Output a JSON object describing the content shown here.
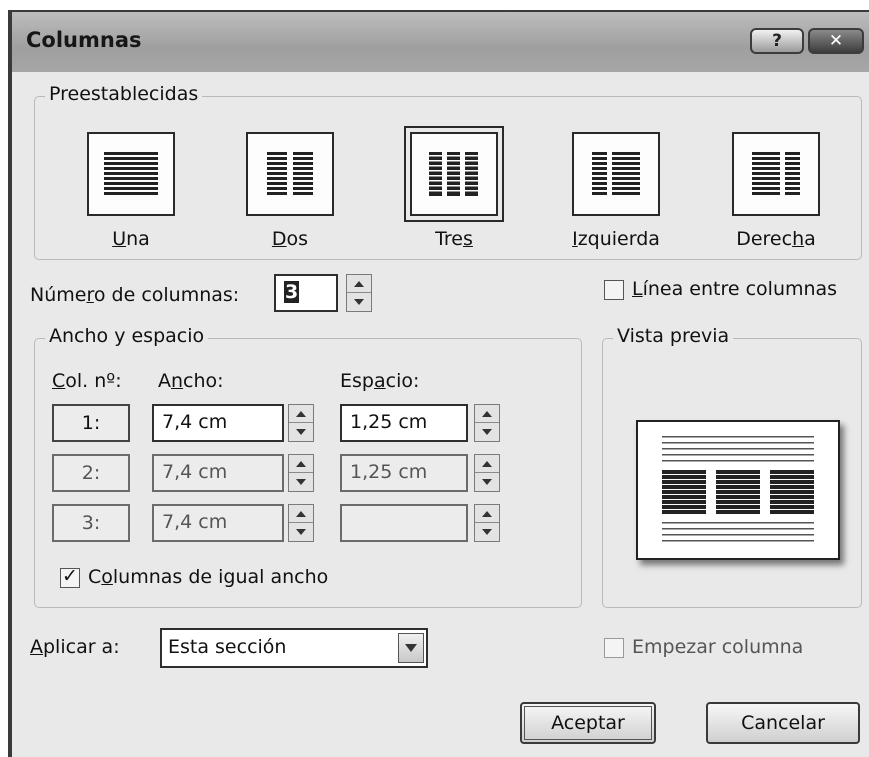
{
  "dialog": {
    "title": "Columnas",
    "help_button": "?",
    "close_button": "✕"
  },
  "presets": {
    "legend": "Preestablecidas",
    "items": [
      {
        "label_pre": "",
        "label_u": "U",
        "label_post": "na",
        "selected": false
      },
      {
        "label_pre": "",
        "label_u": "D",
        "label_post": "os",
        "selected": false
      },
      {
        "label_pre": "Tre",
        "label_u": "s",
        "label_post": "",
        "selected": true
      },
      {
        "label_pre": "",
        "label_u": "I",
        "label_post": "zquierda",
        "selected": false
      },
      {
        "label_pre": "Derec",
        "label_u": "h",
        "label_post": "a",
        "selected": false
      }
    ]
  },
  "num_columns": {
    "label_pre": "Núme",
    "label_u": "r",
    "label_post": "o de columnas:",
    "value": "3"
  },
  "line_between": {
    "label_u": "L",
    "label_post": "ínea entre columnas",
    "checked": false
  },
  "width_spacing": {
    "legend": "Ancho y espacio",
    "col_header_u": "C",
    "col_header_post": "ol. nº:",
    "width_header_pre": "A",
    "width_header_u": "n",
    "width_header_post": "cho:",
    "space_header_pre": "Esp",
    "space_header_u": "a",
    "space_header_post": "cio:",
    "rows": [
      {
        "col": "1:",
        "width": "7,4 cm",
        "space": "1,25 cm",
        "enabled": true
      },
      {
        "col": "2:",
        "width": "7,4 cm",
        "space": "1,25 cm",
        "enabled": false
      },
      {
        "col": "3:",
        "width": "7,4 cm",
        "space": "",
        "enabled": false
      }
    ],
    "equal_width": {
      "label_pre": "C",
      "label_u": "o",
      "label_post": "lumnas de igual ancho",
      "checked": true
    }
  },
  "preview": {
    "legend": "Vista previa"
  },
  "apply_to": {
    "label_u": "A",
    "label_post": "plicar a:",
    "value": "Esta sección"
  },
  "start_column": {
    "label": "Empezar columna",
    "checked": false
  },
  "buttons": {
    "ok": "Aceptar",
    "cancel": "Cancelar"
  },
  "icons": {
    "help": "help-icon",
    "close": "close-icon",
    "checkmark": "checkmark-icon",
    "dropdown": "chevron-down-icon"
  }
}
